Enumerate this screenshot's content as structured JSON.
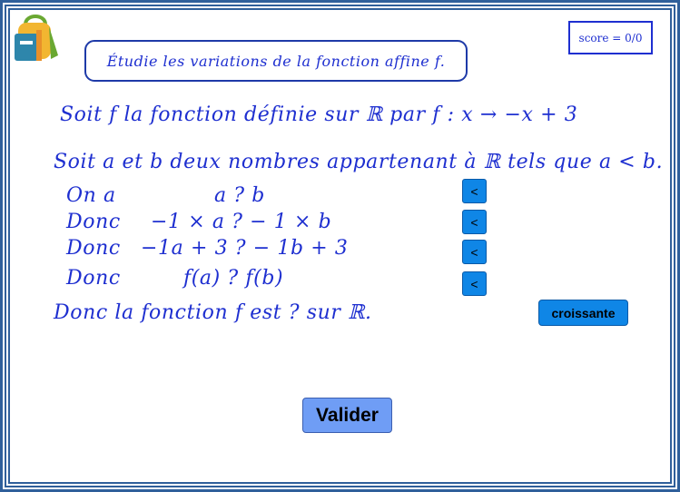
{
  "app": {
    "instruction": "Étudie les variations de la fonction affine f.",
    "score": "score = 0/0"
  },
  "exercise": {
    "statement": "Soit f la fonction définie sur ℝ par f : x → −x + 3",
    "hypothesis": "Soit a et b deux nombres appartenant à ℝ tels que a < b.",
    "steps": [
      {
        "lead": "On a",
        "expr": "a ? b",
        "answer": "<"
      },
      {
        "lead": "Donc",
        "expr": "−1 × a ? − 1 × b",
        "answer": "<"
      },
      {
        "lead": "Donc",
        "expr": "−1a + 3 ? − 1b + 3",
        "answer": "<"
      },
      {
        "lead": "Donc",
        "expr": "f(a) ? f(b)",
        "answer": "<"
      }
    ],
    "conclusion": "Donc la fonction f est ? sur ℝ.",
    "variation_choice": "croissante"
  },
  "actions": {
    "validate_label": "Valider"
  },
  "colors": {
    "text": "#1e2fd0",
    "button": "#0f86e6",
    "validate": "#6f9df5",
    "frame": "#2f5f9a"
  },
  "icons": {
    "logo": "backpack-icon"
  }
}
